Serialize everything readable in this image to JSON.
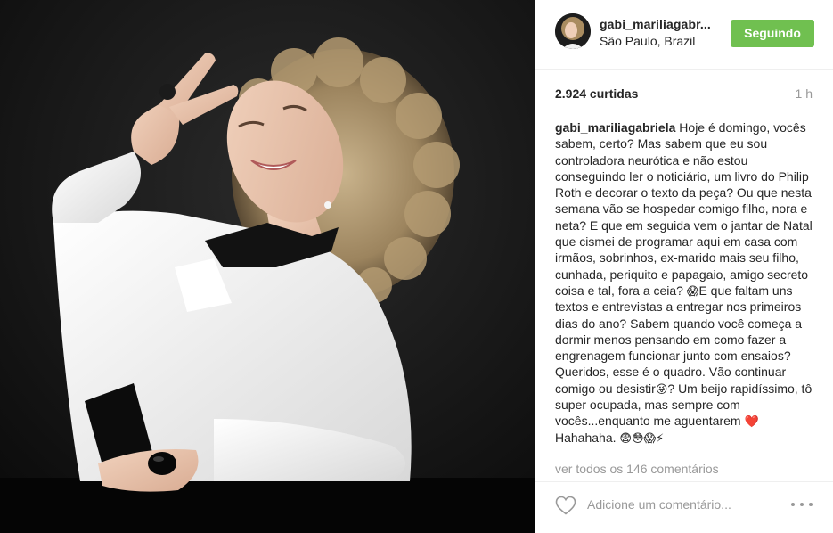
{
  "post": {
    "author": {
      "username": "gabi_mariliagabr...",
      "location": "São Paulo, Brazil",
      "follow_label": "Seguindo"
    },
    "likes": "2.924 curtidas",
    "time": "1 h",
    "caption": {
      "author": "gabi_mariliagabriela",
      "part1": "Hoje é domingo, vocês sabem, certo? Mas sabem que eu sou controladora neurótica e não estou conseguindo ler o noticiário, um livro do Philip Roth e decorar o texto da peça? Ou que nesta semana vão se hospedar comigo filho, nora e neta? E que em seguida vem o jantar de Natal que cismei de programar aqui em casa com irmãos, sobrinhos, ex-marido mais seu filho, cunhada, periquito e papagaio, amigo secreto coisa e tal, fora a ceia?",
      "emoji1": "😱",
      "part2": "E que faltam uns textos e entrevistas a entregar nos primeiros dias do ano? Sabem quando você começa a dormir menos pensando em como fazer a engrenagem funcionar junto com ensaios? Queridos, esse é o quadro. Vão continuar comigo ou desistir",
      "emoji2": "😜",
      "part3": "? Um beijo rapidíssimo, tô super ocupada, mas sempre com vocês...enquanto me aguentarem",
      "emoji3": "❤️",
      "part4": "Hahahaha.",
      "emoji4": "😨😳😱⚡"
    },
    "view_all_comments": "ver todos os 146 comentários",
    "comment_placeholder": "Adicione um comentário...",
    "icons": {
      "like": "heart-outline-icon",
      "more": "more-options-icon"
    },
    "colors": {
      "follow_button": "#70c050",
      "muted_text": "#999999",
      "divider": "#efefef"
    }
  }
}
